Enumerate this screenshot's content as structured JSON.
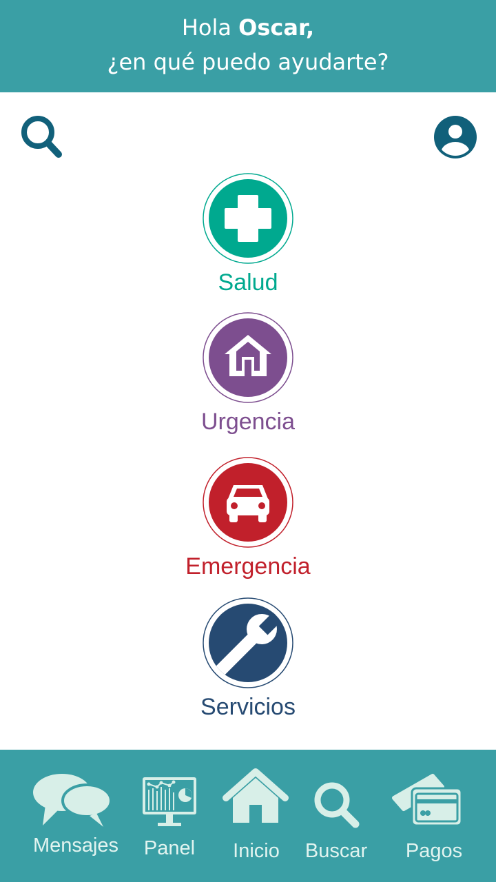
{
  "header": {
    "greeting": "Hola",
    "user_name": "Oscar,",
    "question": "¿en qué puedo ayudarte?"
  },
  "toolbar": {
    "search_icon": "search-icon",
    "profile_icon": "user-profile-icon"
  },
  "categories": [
    {
      "label": "Salud",
      "icon": "medical-cross-icon",
      "color": "#00a98f"
    },
    {
      "label": "Urgencia",
      "icon": "home-icon",
      "color": "#7d4e8f"
    },
    {
      "label": "Emergencia",
      "icon": "car-icon",
      "color": "#c1202b"
    },
    {
      "label": "Servicios",
      "icon": "wrench-icon",
      "color": "#264a72"
    }
  ],
  "nav": {
    "items": [
      {
        "label": "Mensajes",
        "icon": "chat-bubbles-icon"
      },
      {
        "label": "Panel",
        "icon": "dashboard-monitor-icon"
      },
      {
        "label": "Inicio",
        "icon": "home-icon"
      },
      {
        "label": "Buscar",
        "icon": "search-icon"
      },
      {
        "label": "Pagos",
        "icon": "credit-card-icon"
      }
    ]
  },
  "colors": {
    "primary": "#3a9fa5",
    "nav_icon": "#d8efe8",
    "top_icons": "#11607a"
  }
}
